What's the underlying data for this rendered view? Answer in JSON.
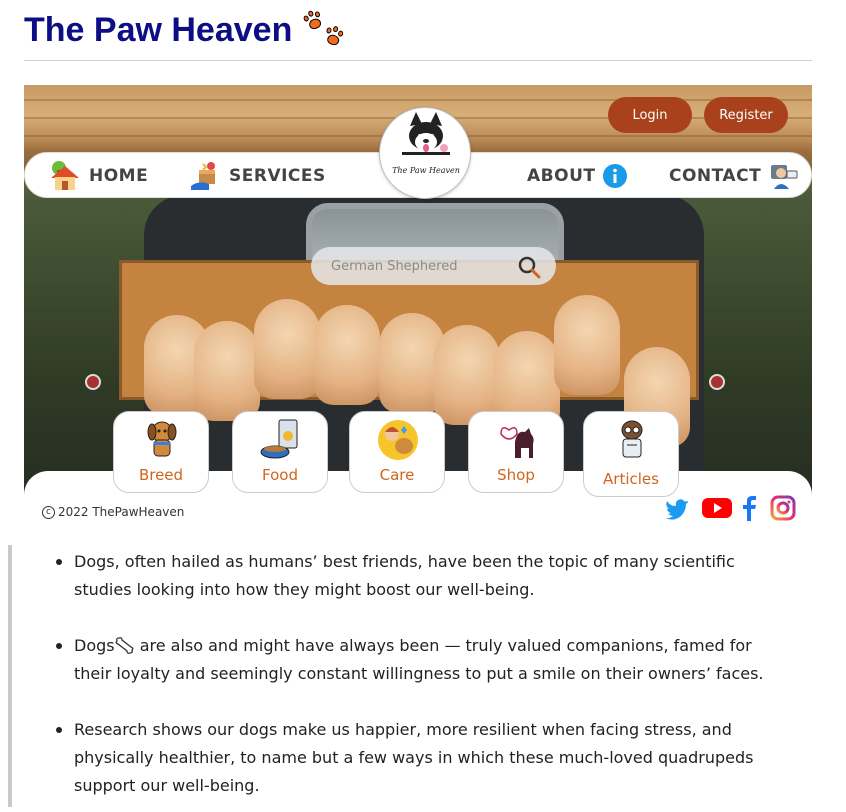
{
  "page": {
    "title": "The Paw Heaven"
  },
  "auth": {
    "login_label": "Login",
    "register_label": "Register"
  },
  "nav": {
    "home": "HOME",
    "services": "SERVICES",
    "about": "ABOUT",
    "contact": "CONTACT"
  },
  "logo": {
    "text": "The Paw Heaven"
  },
  "search": {
    "placeholder": "German Shephered"
  },
  "categories": [
    {
      "label": "Breed",
      "icon": "dog-icon"
    },
    {
      "label": "Food",
      "icon": "dog-food-icon"
    },
    {
      "label": "Care",
      "icon": "care-icon"
    },
    {
      "label": "Shop",
      "icon": "shop-icon"
    },
    {
      "label": "Articles",
      "icon": "articles-icon"
    }
  ],
  "footer": {
    "copyright": "2022 ThePawHeaven"
  },
  "social": [
    "twitter-icon",
    "youtube-icon",
    "facebook-icon",
    "instagram-icon"
  ],
  "bullets": [
    {
      "text": "Dogs, often hailed as humans’ best friends, have been the topic of many scientific studies looking into how they might boost our well-being."
    },
    {
      "before": "Dogs",
      "after": " are also and might have always been — truly valued companions, famed for their loyalty and seemingly constant willingness to put a smile on their owners’ faces."
    },
    {
      "text": "Research shows our dogs make us happier, more resilient when facing stress, and physically healthier, to name but a few ways in which these much-loved quadrupeds support our well-being."
    }
  ],
  "colors": {
    "title": "#0d0d85",
    "button": "#a9411c",
    "category_label": "#d0651c",
    "about_icon": "#1a9be8"
  }
}
